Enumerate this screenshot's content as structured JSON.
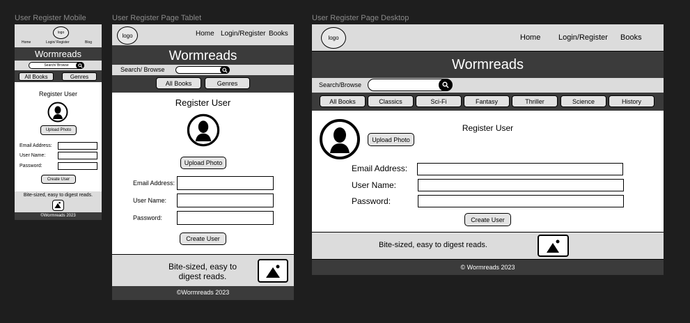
{
  "frames": {
    "mobile": {
      "label": "User Register Mobile",
      "logo": "logo",
      "nav": [
        "Home",
        "Login/ Register",
        "Blog"
      ],
      "brand": "Wormreads",
      "search_placeholder": "Search/ Browse",
      "filters": [
        "All Books",
        "Genres"
      ],
      "heading": "Register User",
      "upload": "Upload Photo",
      "fields": [
        "Email Address:",
        "User Name:",
        "Password:"
      ],
      "submit": "Create User",
      "tagline": "Bite-sized, easy to digest reads.",
      "copyright": "©Wormreads 2023"
    },
    "tablet": {
      "label": "User Register Page Tablet",
      "logo": "logo",
      "nav": [
        "Home",
        "Login/Register",
        "Books"
      ],
      "brand": "Wormreads",
      "search_label": "Search/ Browse",
      "filters": [
        "All Books",
        "Genres"
      ],
      "heading": "Register User",
      "upload": "Upload Photo",
      "fields": [
        "Email Address:",
        "User Name:",
        "Password:"
      ],
      "submit": "Create User",
      "tagline_line1": "Bite-sized, easy to",
      "tagline_line2": "digest reads.",
      "copyright": "©Wormreads 2023"
    },
    "desktop": {
      "label": "User Register Page Desktop",
      "logo": "logo",
      "nav": [
        "Home",
        "Login/Register",
        "Books"
      ],
      "brand": "Wormreads",
      "search_label": "Search/Browse",
      "genres": [
        "All Books",
        "Classics",
        "Sci-Fi",
        "Fantasy",
        "Thriller",
        "Science",
        "History"
      ],
      "heading": "Register User",
      "upload": "Upload Photo",
      "fields": [
        "Email Address:",
        "User Name:",
        "Password:"
      ],
      "submit": "Create User",
      "tagline": "Bite-sized, easy to digest reads.",
      "copyright": "© Wormreads 2023"
    }
  },
  "colors": {
    "background": "#1e1e1e",
    "bar_light": "#dcdcdc",
    "bar_dark": "#3b3b3b",
    "button": "#e4e4e4"
  },
  "icons": [
    "user-avatar-icon",
    "search-icon",
    "image-placeholder-icon"
  ]
}
